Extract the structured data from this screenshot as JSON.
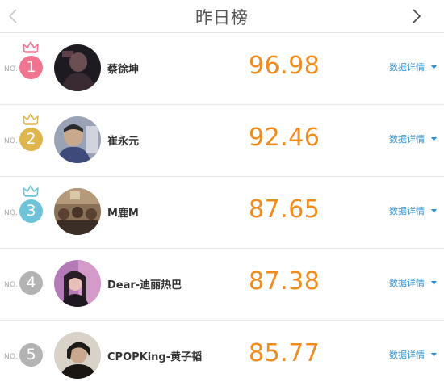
{
  "header": {
    "title": "昨日榜",
    "prev_icon": "chevron-left-icon",
    "next_icon": "chevron-right-icon"
  },
  "no_label": "NO.",
  "detail_label": "数据详情",
  "colors": {
    "rank_1": "#f0738f",
    "rank_2": "#dfb64e",
    "rank_3": "#6ec3d8",
    "rank_other": "#b3b3b3",
    "score": "#f08c1f",
    "link": "#2a8fd6"
  },
  "rankings": [
    {
      "rank": "1",
      "name": "蔡徐坤",
      "score": "96.98"
    },
    {
      "rank": "2",
      "name": "崔永元",
      "score": "92.46"
    },
    {
      "rank": "3",
      "name": "M鹿M",
      "score": "87.65"
    },
    {
      "rank": "4",
      "name": "Dear-迪丽热巴",
      "score": "87.38"
    },
    {
      "rank": "5",
      "name": "CPOPKing-黄子韬",
      "score": "85.77"
    }
  ]
}
